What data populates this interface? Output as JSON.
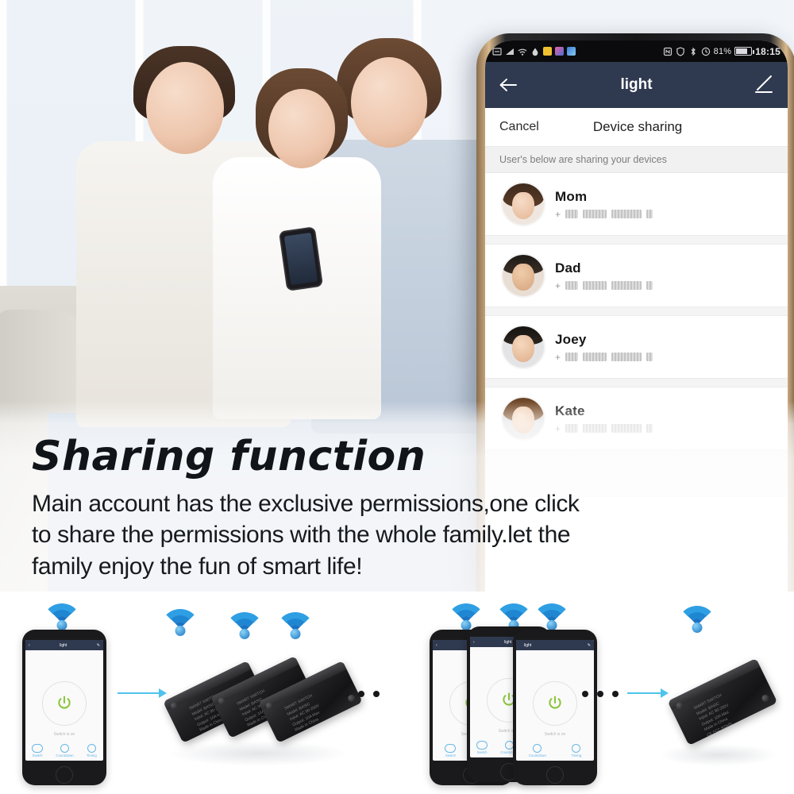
{
  "hero": {
    "headline": "Sharing  function",
    "body": "Main account has the exclusive permissions,one click\nto share the permissions with the whole family.let the\nfamily enjoy the fun of smart life!"
  },
  "phone": {
    "status_bar": {
      "battery_percent": "81%",
      "time": "18:15",
      "left_icons": [
        "screenshot-icon",
        "signal-icon",
        "wifi-icon",
        "water-drop-icon",
        "app-badge-yellow-icon",
        "app-badge-photo-icon",
        "app-badge-home-icon"
      ],
      "right_icons": [
        "nfc-icon",
        "shield-icon",
        "bluetooth-icon",
        "alarm-icon"
      ]
    },
    "appbar": {
      "title": "light",
      "back_icon": "back-arrow-icon",
      "edit_icon": "pencil-icon"
    },
    "sheet": {
      "cancel_label": "Cancel",
      "title": "Device sharing",
      "hint": "User's below are sharing your devices"
    },
    "users": [
      {
        "name": "Mom",
        "phone_masked": "+00 0000 00000 0",
        "avatar": "avatar-mom",
        "hair": "#3f2a1d",
        "skin": "#f3d3ba"
      },
      {
        "name": "Dad",
        "phone_masked": "+00 0000 00000 0",
        "avatar": "avatar-dad",
        "hair": "#1f1a16",
        "skin": "#e8bf9c"
      },
      {
        "name": "Joey",
        "phone_masked": "+00 0000 00000 0",
        "avatar": "avatar-joey",
        "hair": "#15120f",
        "skin": "#f0cdb0"
      },
      {
        "name": "Kate",
        "phone_masked": "+00 0000 00000 0",
        "avatar": "avatar-kate",
        "hair": "#6b4326",
        "skin": "#f6dcc6"
      }
    ]
  },
  "diagram": {
    "app_screen": {
      "title": "light",
      "status_text": "Switch is on",
      "tabs": [
        {
          "label": "Switch",
          "icon": "toggle-icon"
        },
        {
          "label": "Countdown",
          "icon": "countdown-icon"
        },
        {
          "label": "Timing",
          "icon": "timer-icon"
        }
      ]
    },
    "module_label": "SMART SWITCH\nModel: BASIC\nInput: AC 90-250V\nOutput: 10A Max\nMade in China\nCE FCC ROHS",
    "left_group": {
      "phone_count": 1,
      "device_count": 3,
      "wifi_count_over_phones": 1,
      "wifi_count_over_devices": 3,
      "ellipsis": "•••",
      "arrow": "arrow-right-icon"
    },
    "right_group": {
      "phone_count": 3,
      "device_count": 1,
      "wifi_count_over_phones": 3,
      "wifi_count_over_devices": 1,
      "ellipsis": "•••",
      "arrow": "arrow-right-icon"
    }
  },
  "colors": {
    "appbar_navy": "#2f394f",
    "wifi_blue": "#1d86d6",
    "arrow_blue": "#4fc3ec",
    "power_green": "#8cc63f",
    "tab_blue": "#67b7e8"
  }
}
